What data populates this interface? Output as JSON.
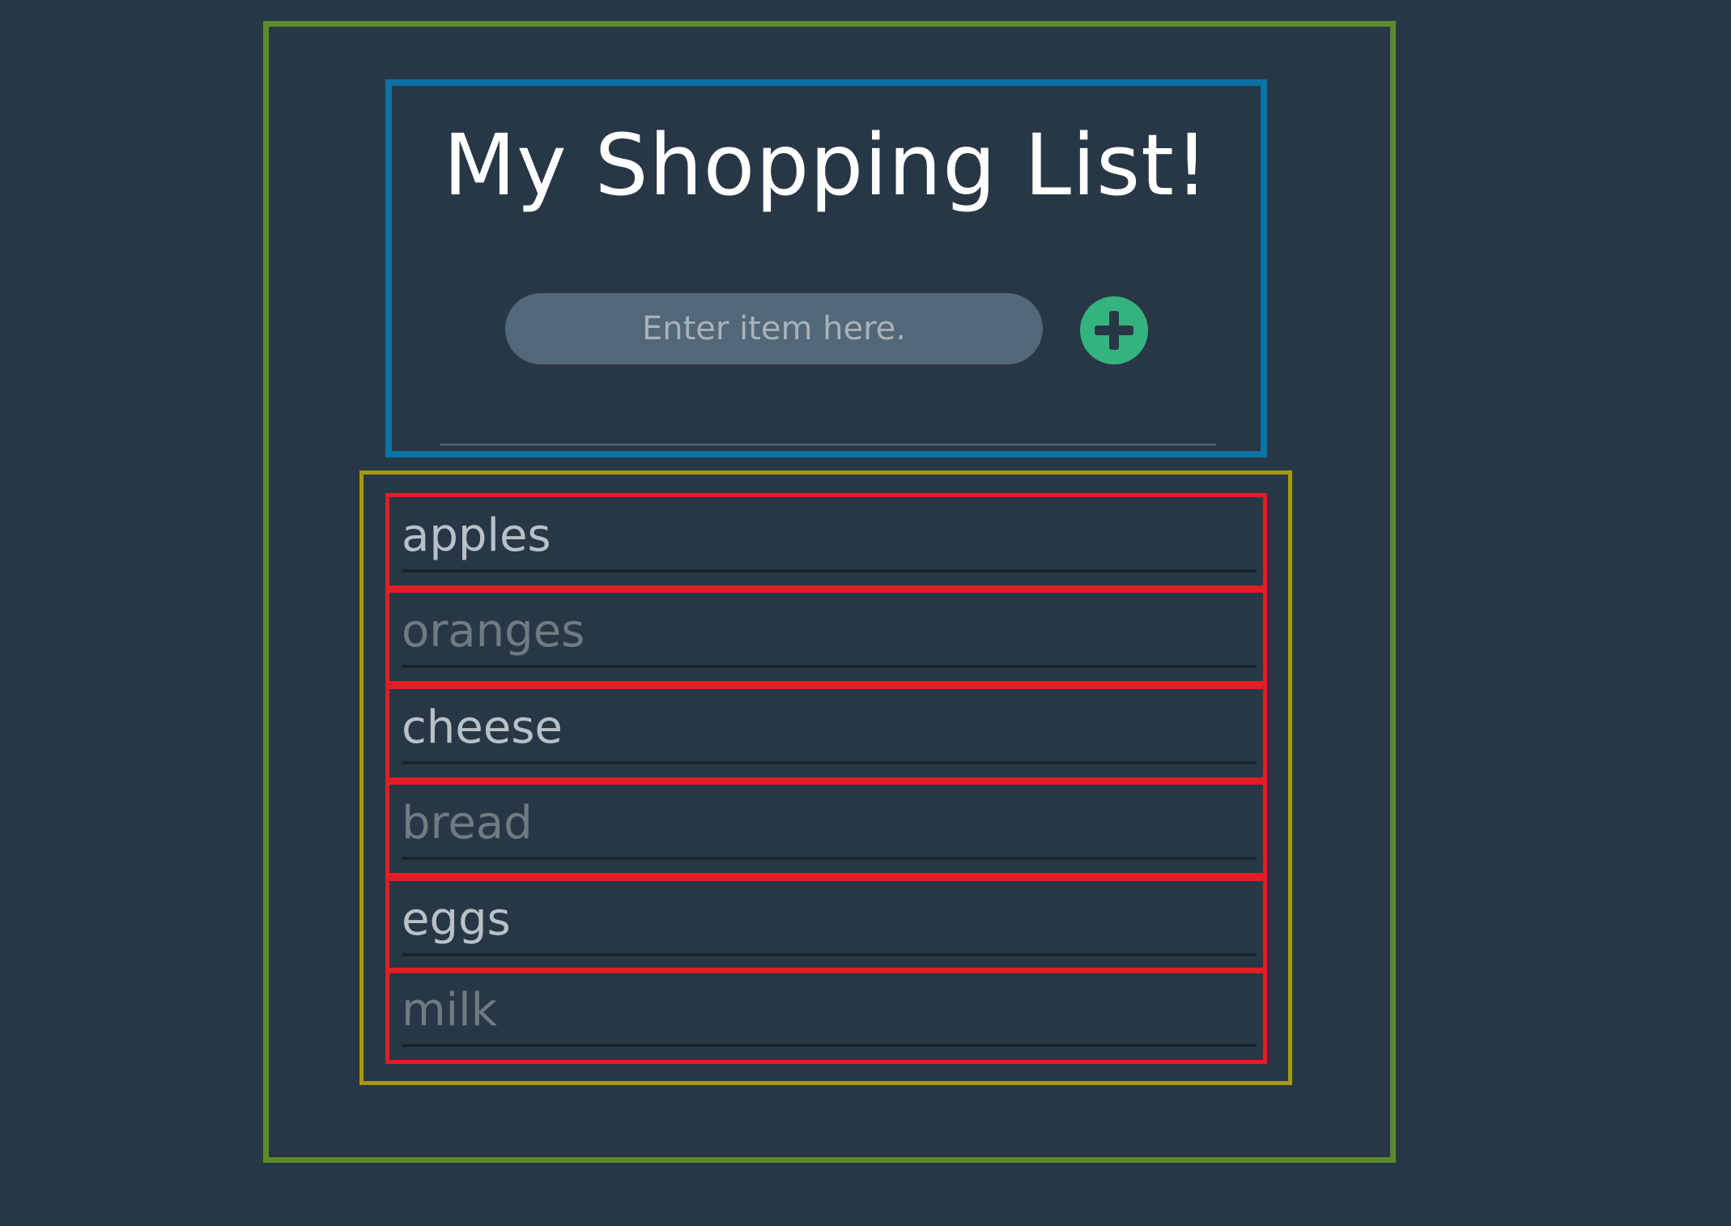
{
  "header": {
    "title": "My Shopping List!",
    "input_placeholder": "Enter item here.",
    "add_icon": "plus-circle-icon"
  },
  "list": {
    "items": [
      {
        "label": "apples",
        "state": "active"
      },
      {
        "label": "oranges",
        "state": "muted"
      },
      {
        "label": "cheese",
        "state": "active"
      },
      {
        "label": "bread",
        "state": "muted"
      },
      {
        "label": "eggs",
        "state": "active"
      },
      {
        "label": "milk",
        "state": "muted"
      }
    ]
  },
  "colors": {
    "background": "#283745",
    "outer_border": "#5c8a2c",
    "header_border": "#0a72a4",
    "list_border": "#a6990e",
    "item_border": "#e11d25",
    "add_button": "#35b37e",
    "input_background": "#526777"
  }
}
